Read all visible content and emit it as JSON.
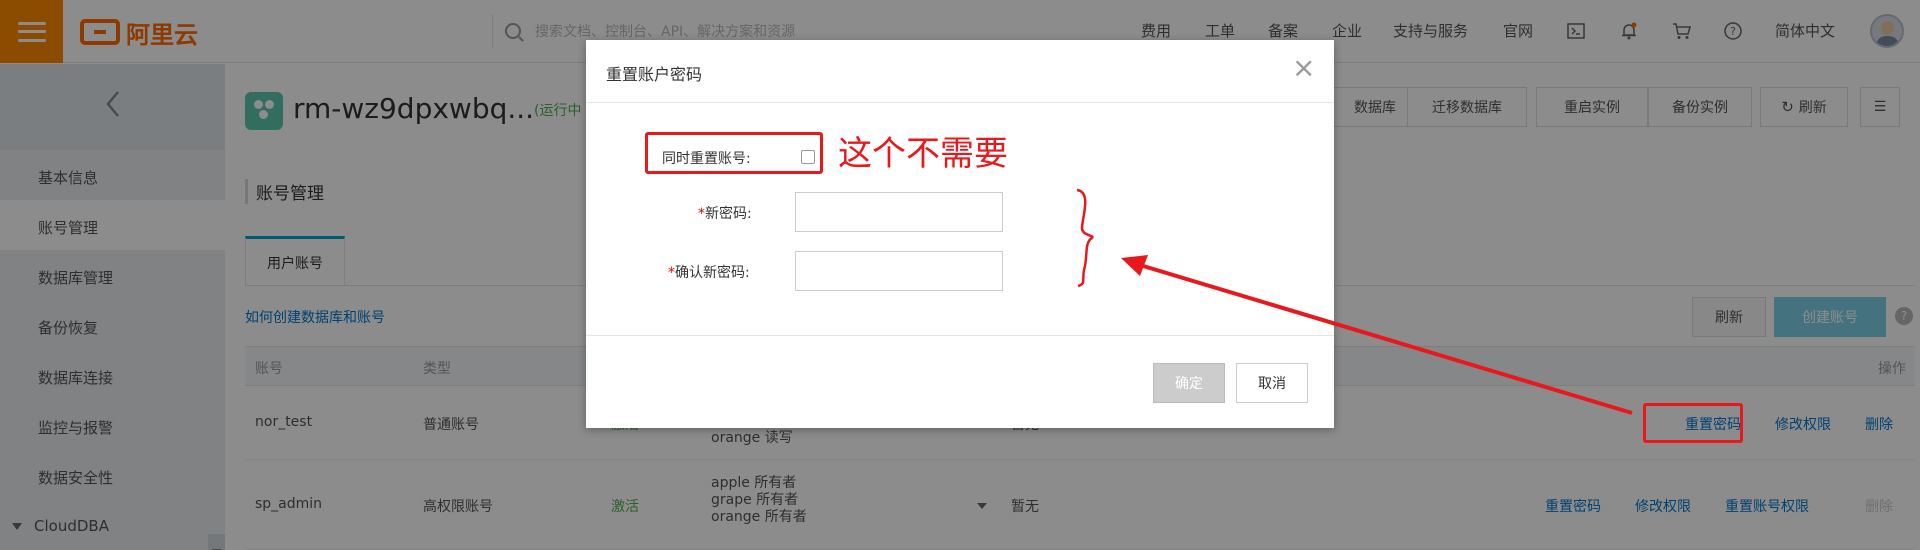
{
  "topbar": {
    "logo_text": "阿里云",
    "search_placeholder": "搜索文档、控制台、API、解决方案和资源",
    "nav": [
      "费用",
      "工单",
      "备案",
      "企业",
      "支持与服务",
      "官网"
    ],
    "icons": [
      "terminal-icon",
      "bell-icon",
      "cart-icon",
      "help-icon"
    ],
    "language": "简体中文"
  },
  "sidebar": {
    "items": [
      "基本信息",
      "账号管理",
      "数据库管理",
      "备份恢复",
      "数据库连接",
      "监控与报警",
      "数据安全性"
    ],
    "group": "CloudDBA"
  },
  "instance": {
    "name": "rm-wz9dpxwbq...",
    "status": "(运行中",
    "actions": [
      "数据库",
      "迁移数据库",
      "重启实例",
      "备份实例",
      "刷新"
    ]
  },
  "page": {
    "section_title": "账号管理",
    "tab": "用户账号",
    "help_link": "如何创建数据库和账号",
    "refresh": "刷新",
    "create": "创建账号",
    "help_q": "?"
  },
  "table": {
    "headers": {
      "account": "账号",
      "type": "类型",
      "actions": "操作"
    },
    "rows": [
      {
        "account": "nor_test",
        "type": "普通账号",
        "status": "激活",
        "privileges": [
          "orange 读写"
        ],
        "desc": "暂无",
        "actions": [
          "重置密码",
          "修改权限",
          "删除"
        ]
      },
      {
        "account": "sp_admin",
        "type": "高权限账号",
        "status": "激活",
        "privileges": [
          "apple 所有者",
          "grape 所有者",
          "orange 所有者"
        ],
        "desc": "暂无",
        "actions": [
          "重置密码",
          "修改权限",
          "重置账号权限",
          "删除"
        ]
      }
    ]
  },
  "dialog": {
    "title": "重置账户密码",
    "reset_account_label": "同时重置账号:",
    "new_password_label": "新密码:",
    "confirm_password_label": "确认新密码:",
    "required_mark": "*",
    "ok": "确定",
    "cancel": "取消",
    "close": "×"
  },
  "annotation": {
    "text": "这个不需要",
    "color": "#e8191c"
  },
  "colors": {
    "accent": "#ff8a00",
    "link": "#0077cc",
    "active_tab": "#00a2ca",
    "status_green": "#4caf50"
  }
}
